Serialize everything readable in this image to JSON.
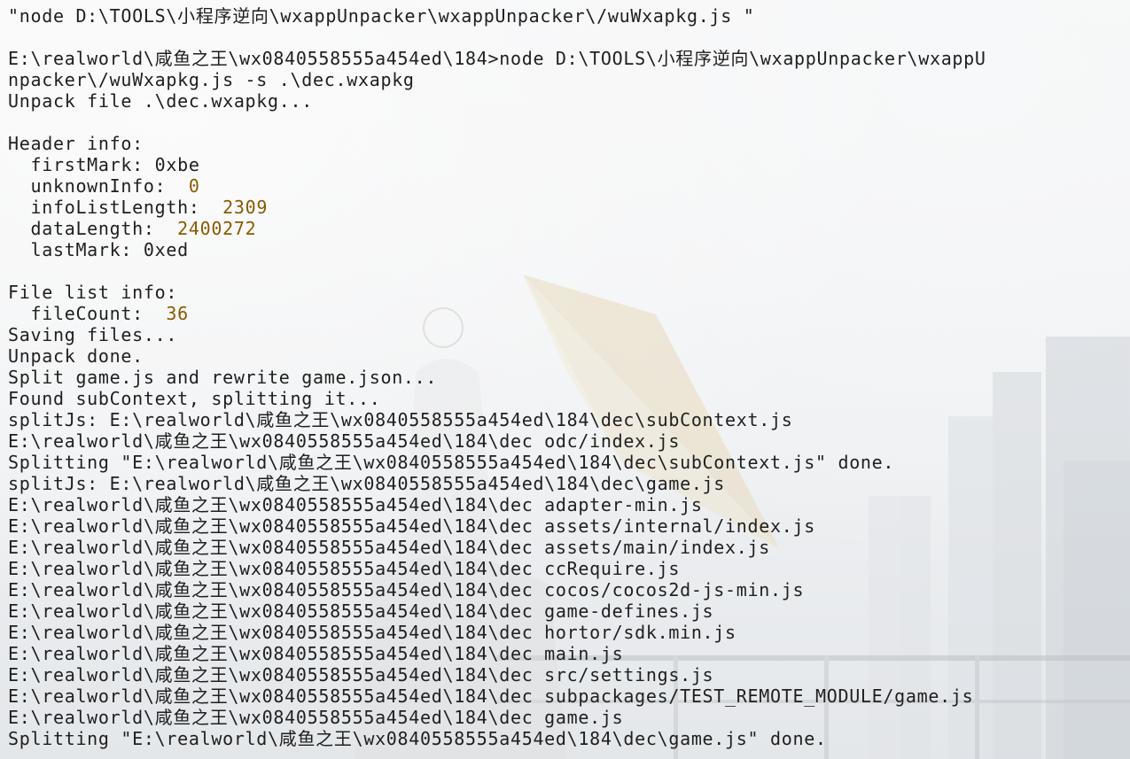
{
  "terminal": {
    "lines": [
      {
        "text": "\"node D:\\TOOLS\\小程序逆向\\wxappUnpacker\\wxappUnpacker\\/wuWxapkg.js \""
      },
      {
        "text": ""
      },
      {
        "text": "E:\\realworld\\咸鱼之王\\wx0840558555a454ed\\184>node D:\\TOOLS\\小程序逆向\\wxappUnpacker\\wxappU"
      },
      {
        "text": "npacker\\/wuWxapkg.js -s .\\dec.wxapkg"
      },
      {
        "text": "Unpack file .\\dec.wxapkg..."
      },
      {
        "text": ""
      },
      {
        "text": "Header info:"
      },
      {
        "text": "  firstMark: 0xbe"
      },
      {
        "text": "  unknownInfo:  ",
        "value": "0"
      },
      {
        "text": "  infoListLength:  ",
        "value": "2309"
      },
      {
        "text": "  dataLength:  ",
        "value": "2400272"
      },
      {
        "text": "  lastMark: 0xed"
      },
      {
        "text": ""
      },
      {
        "text": "File list info:"
      },
      {
        "text": "  fileCount:  ",
        "value": "36"
      },
      {
        "text": "Saving files..."
      },
      {
        "text": "Unpack done."
      },
      {
        "text": "Split game.js and rewrite game.json..."
      },
      {
        "text": "Found subContext, splitting it..."
      },
      {
        "text": "splitJs: E:\\realworld\\咸鱼之王\\wx0840558555a454ed\\184\\dec\\subContext.js"
      },
      {
        "text": "E:\\realworld\\咸鱼之王\\wx0840558555a454ed\\184\\dec odc/index.js"
      },
      {
        "text": "Splitting \"E:\\realworld\\咸鱼之王\\wx0840558555a454ed\\184\\dec\\subContext.js\" done."
      },
      {
        "text": "splitJs: E:\\realworld\\咸鱼之王\\wx0840558555a454ed\\184\\dec\\game.js"
      },
      {
        "text": "E:\\realworld\\咸鱼之王\\wx0840558555a454ed\\184\\dec adapter-min.js"
      },
      {
        "text": "E:\\realworld\\咸鱼之王\\wx0840558555a454ed\\184\\dec assets/internal/index.js"
      },
      {
        "text": "E:\\realworld\\咸鱼之王\\wx0840558555a454ed\\184\\dec assets/main/index.js"
      },
      {
        "text": "E:\\realworld\\咸鱼之王\\wx0840558555a454ed\\184\\dec ccRequire.js"
      },
      {
        "text": "E:\\realworld\\咸鱼之王\\wx0840558555a454ed\\184\\dec cocos/cocos2d-js-min.js"
      },
      {
        "text": "E:\\realworld\\咸鱼之王\\wx0840558555a454ed\\184\\dec game-defines.js"
      },
      {
        "text": "E:\\realworld\\咸鱼之王\\wx0840558555a454ed\\184\\dec hortor/sdk.min.js"
      },
      {
        "text": "E:\\realworld\\咸鱼之王\\wx0840558555a454ed\\184\\dec main.js"
      },
      {
        "text": "E:\\realworld\\咸鱼之王\\wx0840558555a454ed\\184\\dec src/settings.js"
      },
      {
        "text": "E:\\realworld\\咸鱼之王\\wx0840558555a454ed\\184\\dec subpackages/TEST_REMOTE_MODULE/game.js"
      },
      {
        "text": "E:\\realworld\\咸鱼之王\\wx0840558555a454ed\\184\\dec game.js"
      },
      {
        "text": "Splitting \"E:\\realworld\\咸鱼之王\\wx0840558555a454ed\\184\\dec\\game.js\" done."
      }
    ]
  },
  "theme": {
    "background": "#f3f4f5",
    "text_color": "#1f1f1f",
    "number_color": "#8a5a00"
  }
}
